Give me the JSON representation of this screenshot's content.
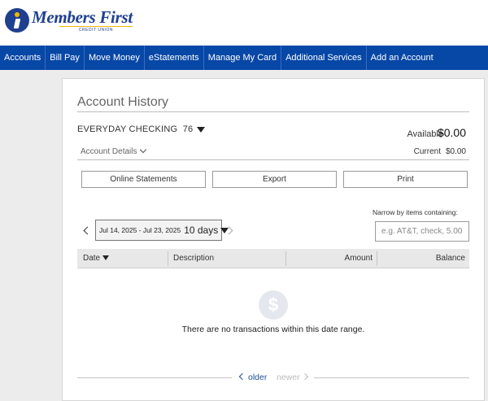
{
  "brand": {
    "name": "Members First",
    "subtitle": "CREDIT UNION",
    "icon": "i-logo-icon",
    "primary_color": "#1f3f8f",
    "accent_color": "#f2b705"
  },
  "nav": {
    "items": [
      "Accounts",
      "Bill Pay",
      "Move Money",
      "eStatements",
      "Manage My Card",
      "Additional Services",
      "Add an Account"
    ],
    "background": "#0747a6"
  },
  "page": {
    "title": "Account History",
    "account": {
      "name": "EVERYDAY CHECKING",
      "number_suffix": "76"
    },
    "available": {
      "label": "Available",
      "value": "$0.00"
    },
    "current": {
      "label": "Current",
      "value": "$0.00"
    },
    "details_label": "Account Details"
  },
  "actions": {
    "online_statements": "Online Statements",
    "export": "Export",
    "print": "Print"
  },
  "filter": {
    "date_range": "Jul 14, 2025 - Jul 23, 2025",
    "days": "10 days",
    "narrow_label": "Narrow by items containing:",
    "search_placeholder": "e.g. AT&T, check, 5.00"
  },
  "table": {
    "columns": {
      "date": "Date",
      "description": "Description",
      "amount": "Amount",
      "balance": "Balance"
    },
    "empty_message": "There are no transactions within this date range.",
    "empty_icon": "dollar-icon",
    "empty_icon_glyph": "$"
  },
  "pager": {
    "older": "older",
    "newer": "newer"
  }
}
